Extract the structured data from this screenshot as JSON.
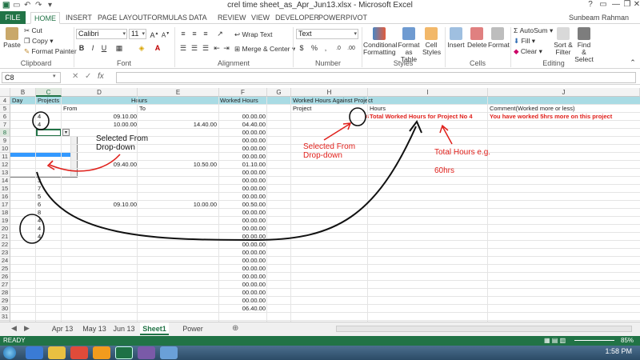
{
  "titlebar": {
    "title": "crel time sheet_as_Apr_Jun13.xlsx - Microsoft Excel"
  },
  "tabs": [
    "FILE",
    "HOME",
    "INSERT",
    "PAGE LAYOUT",
    "FORMULAS",
    "DATA",
    "REVIEW",
    "VIEW",
    "DEVELOPER",
    "POWERPIVOT"
  ],
  "user": "Sunbeam Rahman",
  "ribbon": {
    "clipboard": {
      "paste": "Paste",
      "cut": "Cut",
      "copy": "Copy",
      "format_painter": "Format Painter",
      "label": "Clipboard"
    },
    "font": {
      "name": "Calibri",
      "size": "11",
      "label": "Font"
    },
    "alignment": {
      "wrap": "Wrap Text",
      "merge": "Merge & Center",
      "label": "Alignment"
    },
    "number": {
      "format": "Text",
      "label": "Number"
    },
    "styles": {
      "cond": "Conditional Formatting",
      "table": "Format as Table",
      "cell": "Cell Styles",
      "label": "Styles"
    },
    "cells": {
      "insert": "Insert",
      "delete": "Delete",
      "format": "Format",
      "label": "Cells"
    },
    "editing": {
      "autosum": "AutoSum",
      "fill": "Fill",
      "clear": "Clear",
      "sort": "Sort & Filter",
      "find": "Find & Select",
      "label": "Editing"
    }
  },
  "formula_bar": {
    "name_box": "C8",
    "content": ""
  },
  "columns": [
    "B",
    "C",
    "D",
    "E",
    "F",
    "G",
    "H",
    "I",
    "J"
  ],
  "header_row4": {
    "day": "Day",
    "projects": "Projects",
    "hours": "Hours",
    "worked": "Worked Hours",
    "against": "Worked Hours Against Project"
  },
  "header_row5": {
    "from": "From",
    "to": "To",
    "project": "Project",
    "hours": "Hours",
    "comment": "Comment(Worked more or less)"
  },
  "rows": [
    {
      "n": "4"
    },
    {
      "n": "5"
    },
    {
      "n": "6",
      "c": "4",
      "from": "",
      "to": "09.10.00",
      "d": "09.10.00",
      "f": "00.00.00"
    },
    {
      "n": "7",
      "c": "4",
      "d": "10.00.00",
      "e": "14.40.00",
      "f": "04.40.00"
    },
    {
      "n": "8",
      "f": "00.00.00"
    },
    {
      "n": "9",
      "f": "00.00.00"
    },
    {
      "n": "10",
      "f": "00.00.00"
    },
    {
      "n": "11",
      "f": "00.00.00"
    },
    {
      "n": "12",
      "d": "09.40.00",
      "e": "10.50.00",
      "f": "01.10.00"
    },
    {
      "n": "13",
      "f": "00.00.00"
    },
    {
      "n": "14",
      "c": "3",
      "f": "00.00.00"
    },
    {
      "n": "15",
      "c": "7",
      "f": "00.00.00"
    },
    {
      "n": "16",
      "c": "5",
      "f": "00.00.00"
    },
    {
      "n": "17",
      "c": "6",
      "d": "09.10.00",
      "e": "10.00.00",
      "f": "00.50.00"
    },
    {
      "n": "18",
      "c": "8",
      "f": "00.00.00"
    },
    {
      "n": "19",
      "c": "4",
      "f": "00.00.00"
    },
    {
      "n": "20",
      "c": "4",
      "f": "00.00.00"
    },
    {
      "n": "21",
      "c": "4",
      "f": "00.00.00"
    },
    {
      "n": "22",
      "f": "00.00.00"
    },
    {
      "n": "23",
      "f": "00.00.00"
    },
    {
      "n": "24",
      "f": "00.00.00"
    },
    {
      "n": "25",
      "f": "00.00.00"
    },
    {
      "n": "26",
      "f": "00.00.00"
    },
    {
      "n": "27",
      "f": "00.00.00"
    },
    {
      "n": "28",
      "f": "00.00.00"
    },
    {
      "n": "29",
      "f": "00.00.00"
    },
    {
      "n": "30",
      "f": "06.40.00"
    },
    {
      "n": "31"
    },
    {
      "n": "32"
    }
  ],
  "h6_project": "4",
  "i6_total": "Total Worked Hours for Project No 4",
  "j6_comment": "You have worked 5hrs more on this project",
  "dropdown_items": [
    "1",
    "2",
    "3",
    "4",
    "5",
    "6",
    "7",
    "8"
  ],
  "dropdown_selected": "4",
  "annotations": {
    "selected_dropdown_1": "Selected From",
    "selected_dropdown_2": "Drop-down",
    "selected_right_1": "Selected From",
    "selected_right_2": "Drop-down",
    "total_hours": "Total Hours e.g.",
    "sixty": "60hrs"
  },
  "sheet_tabs": [
    "Apr 13",
    "May 13",
    "Jun 13",
    "Sheet1",
    "Power View1"
  ],
  "active_sheet": "Sheet1",
  "status": "READY",
  "zoom": "85%",
  "clock": "1:58 PM"
}
